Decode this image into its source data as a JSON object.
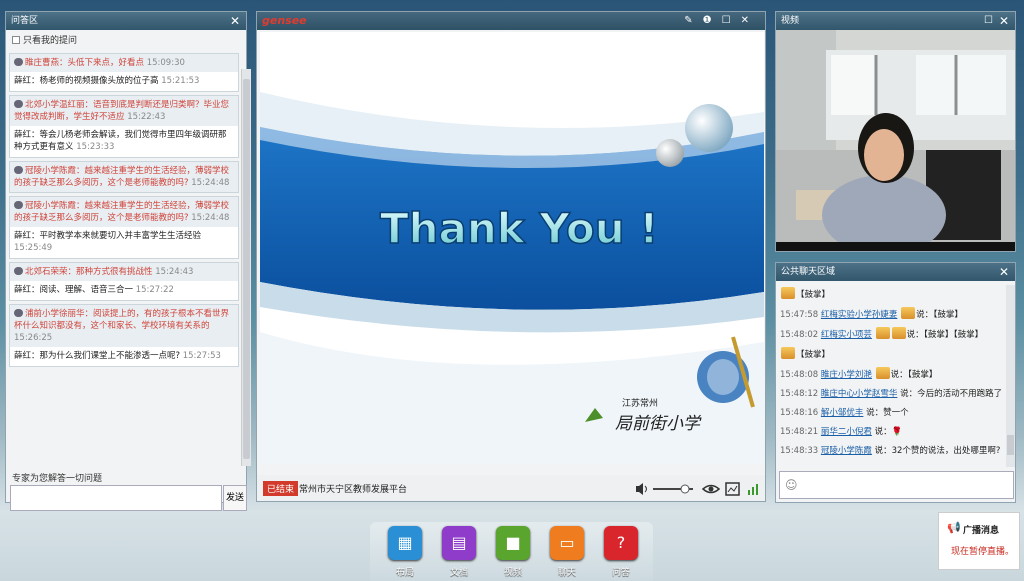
{
  "qa": {
    "title": "问答区",
    "only_mine": "只看我的提问",
    "items": [
      {
        "q": "睢庄曹燕：头低下来点，好看点",
        "qt": "15:09:30",
        "a": "薛红：杨老师的视频摄像头放的位子高",
        "at": "15:21:53"
      },
      {
        "q": "北郊小学温红丽：语音到底是判断还是归类啊？毕业您觉得改成判断，学生好不适应",
        "qt": "15:22:43",
        "a": "薛红：等会儿杨老师会解读，我们觉得市里四年级调研那种方式更有意义",
        "at": "15:23:33"
      },
      {
        "q": "冠陵小学陈霞：越来越注重学生的生活经验，薄弱学校的孩子缺乏那么多阅历，这个是老师能教的吗?",
        "qt": "15:24:48",
        "a": "",
        "at": ""
      },
      {
        "q": "冠陵小学陈霞：越来越注重学生的生活经验，薄弱学校的孩子缺乏那么多阅历，这个是老师能教的吗?",
        "qt": "15:24:48",
        "a": "薛红：平时教学本来就要切入并丰富学生生活经验",
        "at": "15:25:49"
      },
      {
        "q": "北郊石荣荣：那种方式很有挑战性",
        "qt": "15:24:43",
        "a": "薛红：阅读、理解、语音三合一",
        "at": "15:27:22"
      },
      {
        "q": "浦前小学徐丽华：阅读提上的，有的孩子根本不看世界杯什么知识都没有，这个和家长、学校环境有关系的",
        "qt": "15:26:25",
        "a": "薛红：那为什么我们课堂上不能渗透一点呢?",
        "at": "15:27:53"
      }
    ],
    "expert_label": "专家为您解答一切问题",
    "send_label": "发送"
  },
  "main": {
    "logo": "gensee",
    "slide": {
      "title": "Thank You !",
      "school_small": "江苏常州",
      "school_name": "局前街小学"
    },
    "status_ended": "已结束",
    "org": "常州市天宁区教师发展平台",
    "volume_level": 0.8
  },
  "video": {
    "title": "视频"
  },
  "chat": {
    "title": "公共聊天区域",
    "lines": [
      {
        "time": "",
        "name": "",
        "text": "【鼓掌】",
        "emo": 1
      },
      {
        "time": "15:47:58",
        "name": "红梅实验小学孙婕妻",
        "text": "说：【鼓掌】",
        "emo": 1
      },
      {
        "time": "15:48:02",
        "name": "红梅实小项芸",
        "text": "说：【鼓掌】【鼓掌】",
        "emo": 2
      },
      {
        "time": "",
        "name": "",
        "text": "【鼓掌】",
        "emo": 1
      },
      {
        "time": "15:48:08",
        "name": "睢庄小学刘滟",
        "text": "说：【鼓掌】",
        "emo": 1
      },
      {
        "time": "15:48:12",
        "name": "睢庄中心小学赵雪华",
        "text": "说：今后的活动不用跑路了",
        "emo": 0
      },
      {
        "time": "15:48:16",
        "name": "解小邹优丰",
        "text": "说：赞一个",
        "emo": 0
      },
      {
        "time": "15:48:21",
        "name": "丽华二小倪君",
        "text": "说：🌹",
        "emo": 0
      },
      {
        "time": "15:48:33",
        "name": "冠陵小学陈霞",
        "text": "说：32个赞的说法，出处哪里啊?",
        "emo": 0
      }
    ]
  },
  "dock": [
    {
      "label": "布局",
      "color": "#2b8fd6",
      "icon": "layout-icon"
    },
    {
      "label": "文档",
      "color": "#8e3cc9",
      "icon": "document-icon"
    },
    {
      "label": "视频",
      "color": "#5aa52e",
      "icon": "video-icon"
    },
    {
      "label": "聊天",
      "color": "#ef7d1f",
      "icon": "chat-icon"
    },
    {
      "label": "问答",
      "color": "#d8262c",
      "icon": "qa-icon"
    }
  ],
  "broadcast": {
    "title": "广播消息",
    "msg": "现在暂停直播。"
  }
}
